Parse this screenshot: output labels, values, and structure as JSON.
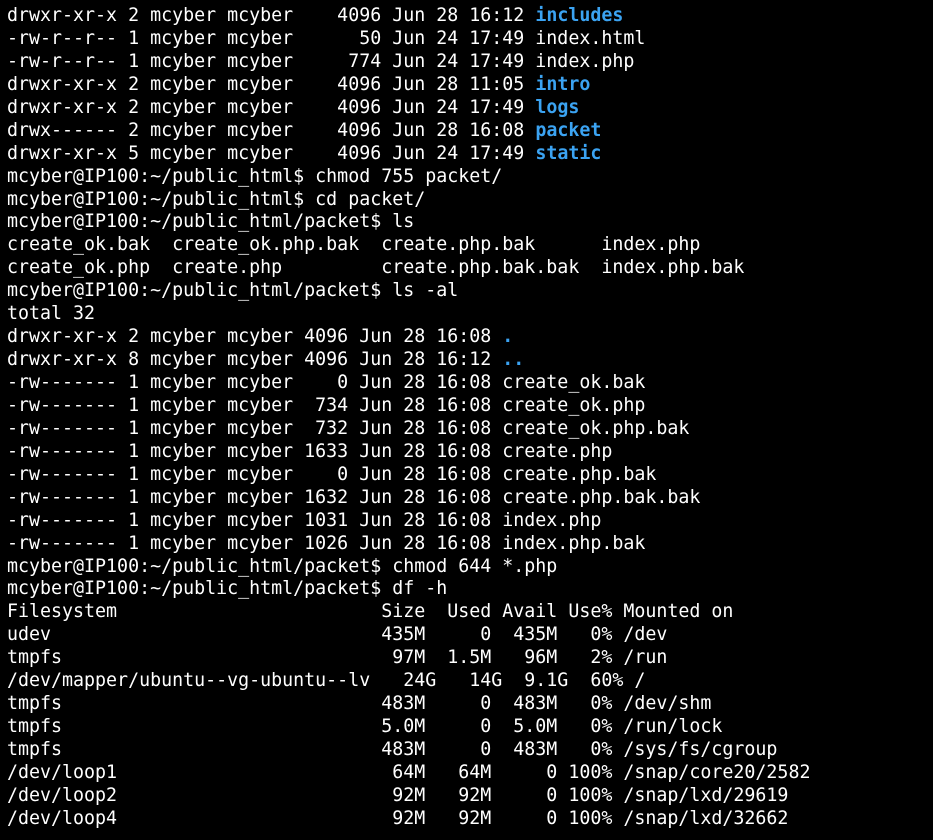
{
  "colors": {
    "background": "#000000",
    "foreground": "#ffffff",
    "directory": "#3ba3f2"
  },
  "terminal": {
    "lines": [
      {
        "text": "drwxr-xr-x 2 mcyber mcyber    4096 Jun 28 16:12 ",
        "name": "includes",
        "dir": true
      },
      {
        "text": "-rw-r--r-- 1 mcyber mcyber      50 Jun 24 17:49 index.html"
      },
      {
        "text": "-rw-r--r-- 1 mcyber mcyber     774 Jun 24 17:49 index.php"
      },
      {
        "text": "drwxr-xr-x 2 mcyber mcyber    4096 Jun 28 11:05 ",
        "name": "intro",
        "dir": true
      },
      {
        "text": "drwxr-xr-x 2 mcyber mcyber    4096 Jun 24 17:49 ",
        "name": "logs",
        "dir": true
      },
      {
        "text": "drwx------ 2 mcyber mcyber    4096 Jun 28 16:08 ",
        "name": "packet",
        "dir": true
      },
      {
        "text": "drwxr-xr-x 5 mcyber mcyber    4096 Jun 24 17:49 ",
        "name": "static",
        "dir": true
      },
      {
        "text": "mcyber@IP100:~/public_html$ chmod 755 packet/",
        "prompt": true
      },
      {
        "text": "mcyber@IP100:~/public_html$ cd packet/",
        "prompt": true
      },
      {
        "text": "mcyber@IP100:~/public_html/packet$ ls",
        "prompt": true
      },
      {
        "text": "create_ok.bak  create_ok.php.bak  create.php.bak      index.php"
      },
      {
        "text": "create_ok.php  create.php         create.php.bak.bak  index.php.bak"
      },
      {
        "text": "mcyber@IP100:~/public_html/packet$ ls -al",
        "prompt": true
      },
      {
        "text": "total 32"
      },
      {
        "text": "drwxr-xr-x 2 mcyber mcyber 4096 Jun 28 16:08 ",
        "name": ".",
        "dir": true
      },
      {
        "text": "drwxr-xr-x 8 mcyber mcyber 4096 Jun 28 16:12 ",
        "name": "..",
        "dir": true
      },
      {
        "text": "-rw------- 1 mcyber mcyber    0 Jun 28 16:08 create_ok.bak"
      },
      {
        "text": "-rw------- 1 mcyber mcyber  734 Jun 28 16:08 create_ok.php"
      },
      {
        "text": "-rw------- 1 mcyber mcyber  732 Jun 28 16:08 create_ok.php.bak"
      },
      {
        "text": "-rw------- 1 mcyber mcyber 1633 Jun 28 16:08 create.php"
      },
      {
        "text": "-rw------- 1 mcyber mcyber    0 Jun 28 16:08 create.php.bak"
      },
      {
        "text": "-rw------- 1 mcyber mcyber 1632 Jun 28 16:08 create.php.bak.bak"
      },
      {
        "text": "-rw------- 1 mcyber mcyber 1031 Jun 28 16:08 index.php"
      },
      {
        "text": "-rw------- 1 mcyber mcyber 1026 Jun 28 16:08 index.php.bak"
      },
      {
        "text": "mcyber@IP100:~/public_html/packet$ chmod 644 *.php",
        "prompt": true
      },
      {
        "text": "mcyber@IP100:~/public_html/packet$ df -h",
        "prompt": true
      },
      {
        "text": "Filesystem                        Size  Used Avail Use% Mounted on"
      },
      {
        "text": "udev                              435M     0  435M   0% /dev"
      },
      {
        "text": "tmpfs                              97M  1.5M   96M   2% /run"
      },
      {
        "text": "/dev/mapper/ubuntu--vg-ubuntu--lv   24G   14G  9.1G  60% /"
      },
      {
        "text": "tmpfs                             483M     0  483M   0% /dev/shm"
      },
      {
        "text": "tmpfs                             5.0M     0  5.0M   0% /run/lock"
      },
      {
        "text": "tmpfs                             483M     0  483M   0% /sys/fs/cgroup"
      },
      {
        "text": "/dev/loop1                         64M   64M     0 100% /snap/core20/2582"
      },
      {
        "text": "/dev/loop2                         92M   92M     0 100% /snap/lxd/29619"
      },
      {
        "text": "/dev/loop4                         92M   92M     0 100% /snap/lxd/32662"
      }
    ]
  }
}
